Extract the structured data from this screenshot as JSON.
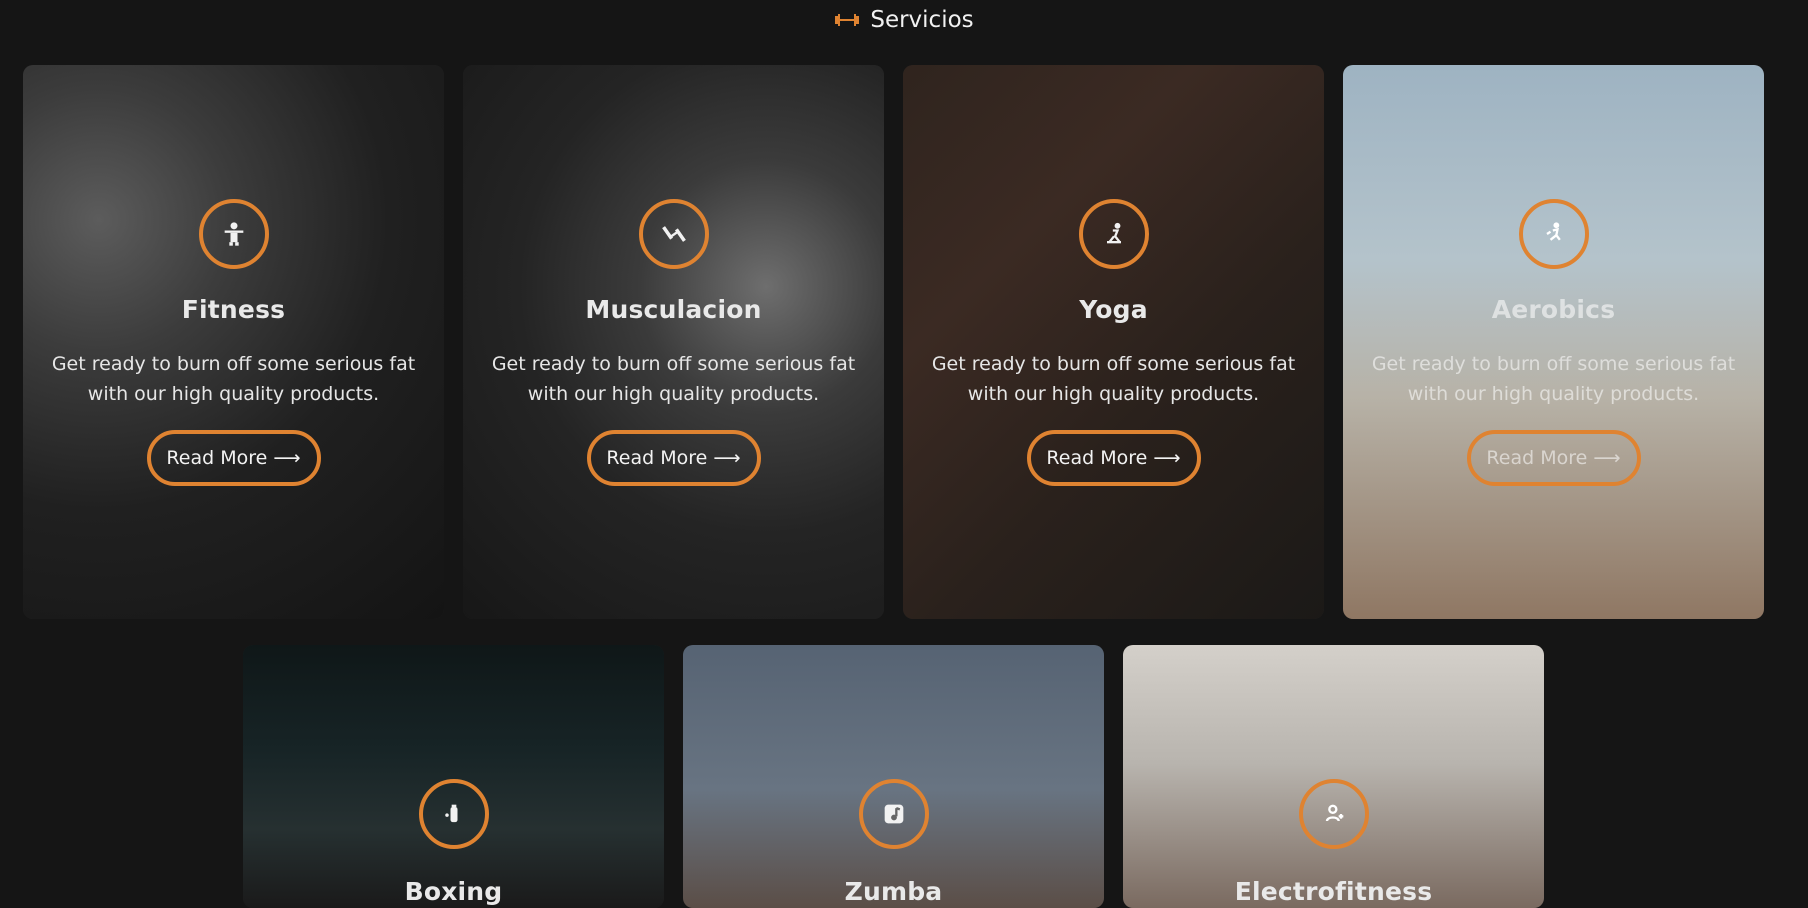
{
  "section": {
    "title": "Servicios",
    "icon": "dumbbell-icon"
  },
  "cards": [
    {
      "title": "Fitness",
      "text": "Get ready to burn off some serious fat with our high quality products.",
      "button": "Read More",
      "icon": "weightlifter-icon"
    },
    {
      "title": "Musculacion",
      "text": "Get ready to burn off some serious fat with our high quality products.",
      "button": "Read More",
      "icon": "dumbbell-icon"
    },
    {
      "title": "Yoga",
      "text": "Get ready to burn off some serious fat with our high quality products.",
      "button": "Read More",
      "icon": "yoga-pose-icon"
    },
    {
      "title": "Aerobics",
      "text": "Get ready to burn off some serious fat with our high quality products.",
      "button": "Read More",
      "icon": "running-person-icon"
    },
    {
      "title": "Boxing",
      "icon": "punching-bag-icon"
    },
    {
      "title": "Zumba",
      "icon": "music-note-icon"
    },
    {
      "title": "Electrofitness",
      "icon": "user-plus-icon"
    }
  ],
  "theme": {
    "accent": "#df8331",
    "background": "#151515"
  }
}
